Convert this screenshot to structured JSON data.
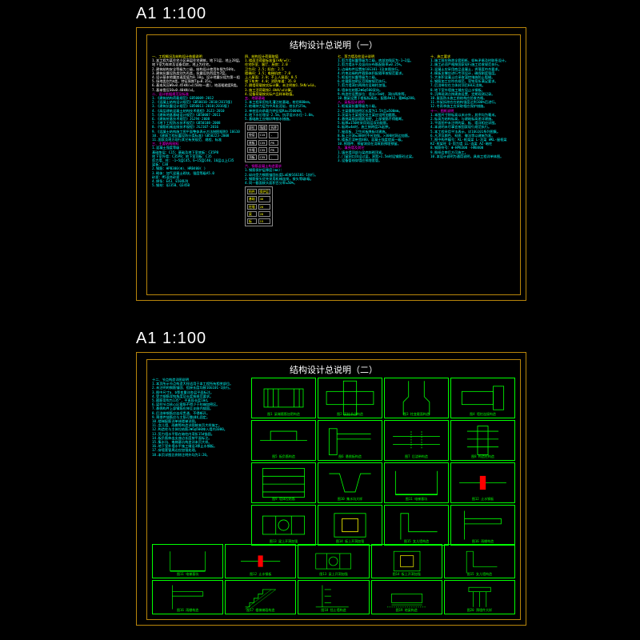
{
  "labels": {
    "sheet1": "A1   1:100",
    "sheet2": "A1   1:100"
  },
  "sheet1": {
    "title": "结构设计总说明（一）",
    "col1_head1": "一、工程概况及结构设计依据说明",
    "col1_lines_a": [
      "1.本工程为某住宅小区高层住宅建筑，地下1层，地上28层。",
      "地下室为车库及设备用房，地上为住宅。",
      "2.建筑结构安全等级为二级，结构设计使用年限为50年。",
      "3.建筑抗震设防类别为丙类，抗震设防烈度为7度。",
      "4.设计基本地震加速度值为0.10g，设计地震分组为第一组。",
      "5.场地类别为Ⅱ类，特征周期Tg=0.35s。",
      "6.基本风压W0=0.45kN/㎡(50年一遇)，地面粗糙度B类。",
      "7.基本雪压S0=0.40kN/㎡。"
    ],
    "col1_head2": "二、设计依据规范及标准",
    "col1_lines_b": [
      "1.《建筑结构荷载规范》GB50009-2012",
      "2.《混凝土结构设计规范》GB50010-2010(2015版)",
      "3.《建筑抗震设计规范》GB50011-2010(2016版)",
      "4.《高层建筑混凝土结构技术规程》JGJ3-2010",
      "5.《建筑地基基础设计规范》GB50007-2011",
      "6.《建筑桩基技术规范》JGJ94-2008",
      "7.《地下工程防水技术规范》GB50108-2008",
      "8.《钢筋机械连接技术规程》JGJ107-2016",
      "9.《混凝土结构施工图平面整体表示方法制图规则》16G101",
      "10.《建筑工程抗震设防分类标准》GB50223-2008",
      "11.国家及地方现行其它有关规范、规程、标准"
    ],
    "col1_head3": "三、主要结构材料",
    "col1_lines_c": [
      "1.混凝土强度等级：",
      "  基础垫层：C15；基础及地下室底板：C35P8",
      "  地下室外墙：C35P8；地下室顶板：C35",
      "  剪力墙、柱：-1~5层C45，6~15层C40，16层以上C35",
      "  梁板：C30",
      "2.钢筋：HPB300(Φ)、HRB400(    )",
      "3.砌体：加气混凝土砌块，强度等级A5.0",
      "  砂浆：M5混合砂浆",
      "4.焊条：E43、E50系列",
      "5.钢材：Q235B、Q345B"
    ],
    "col2_head1": "四、结构设计荷载取值",
    "col2_lines_a": [
      "1.楼面活荷载标准值(kN/㎡)：",
      "  住宅卧室、客厅、厨房：2.0",
      "  卫生间：2.5；阳台：2.5",
      "  楼梯间：3.5；电梯机房：7.0",
      "  上人屋面：2.0；不上人屋面：0.5",
      "  地下车库：4.0；消防车道：35.0",
      "2.隔墙荷载按实际计算，未注明按1.5kN/㎡计。",
      "3.施工活荷载按2.0kN/㎡计算。",
      "4.设备荷载按实际产品样本取值。"
    ],
    "col2_head2": "五、地基基础",
    "col2_lines_b": [
      "1.本工程采用钻孔灌注桩基础，桩径800mm。",
      "2.桩端持力层为中风化泥岩，桩长约25m。",
      "3.单桩竖向承载力特征值Ra=3500kN。",
      "4.地下水位埋深-2.5m，抗浮设计水位-1.0m。",
      "5.基础施工应做好降排水措施。"
    ],
    "col2_table1": {
      "header": [
        "部位",
        "强度",
        "抗渗"
      ],
      "rows": [
        [
          "垫层",
          "C15",
          "-"
        ],
        [
          "底板",
          "C35",
          "P8"
        ],
        [
          "外墙",
          "C35",
          "P8"
        ],
        [
          "顶板",
          "C35",
          "-"
        ]
      ]
    },
    "col2_head3": "六、钢筋混凝土构造要求",
    "col2_lines_c": [
      "1.钢筋保护层厚度(mm)：",
      "2.纵向受力钢筋锚固长度LaE按16G101-1执行。",
      "3.钢筋接头优先采用机械连接，接头等级Ⅰ级。",
      "4.同一截面接头面积百分率≤50%。"
    ],
    "col2_table2": {
      "header": [
        "构件",
        "保护层"
      ],
      "rows": [
        [
          "基础",
          "40"
        ],
        [
          "柱墙",
          "20"
        ],
        [
          "梁",
          "20"
        ],
        [
          "板",
          "15"
        ]
      ]
    },
    "col3_head1": "七、剪力墙及柱设计说明",
    "col3_lines_a": [
      "1.剪力墙抗震等级为二级，底部加强区为-1~2层。",
      "2.剪力墙水平及竖向分布筋配筋率≥0.25%。",
      "3.边缘构件设置按16G101-1及本图执行。",
      "4.约束边缘构件箍筋体积配箍率按规范要求。",
      "5.框架柱抗震等级为二级。",
      "6.柱箍筋加密区范围按规范执行。",
      "7.剪力墙洞口两侧应设暗柱加强。",
      "8.墙体拉结筋2Φ6@500双向。",
      "9.构造柱设置部位：墙长>5m时、洞口两侧等。",
      "10.圈梁设置于楼板标高处，配筋4Φ12，箍Φ6@200。"
    ],
    "col3_head2": "八、梁板设计说明",
    "col3_lines_b": [
      "1.框架梁抗震等级为二级。",
      "2.主梁箍筋加密区长度为1.5h且≥500mm。",
      "3.次梁与主梁相交处主梁应设附加箍筋。",
      "4.悬挑梁根部箍筋加密，上部钢筋不得截断。",
      "5.板厚≥150时采用双层双向配筋。",
      "6.板跨≥4m时，施工按跨度2‰起拱。",
      "7.屋面板、卫生间板降板详建施。",
      "8.板上开洞≤300时不另加强，>300时洞边加筋。",
      "9.楼板后浇带宽800，混凝土强度提高一级。",
      "10.预埋件、预留洞须在浇筑前预埋预留。"
    ],
    "col3_head3": "九、填充墙及其它",
    "col3_lines_c": [
      "1.填充墙顶部与梁底斜砌顶紧。",
      "2.门窗洞口顶设过梁，洞宽>1.5m时设钢筋砼过梁。",
      "3.设备管线穿墙应预埋套管。"
    ],
    "col4_head1": "十、施工要求",
    "col4_lines_a": [
      "1.施工前应熟悉全套图纸，如有矛盾及时联系设计。",
      "2.施工必须严格按国家现行施工验收规范执行。",
      "3.混凝土应采用商品混凝土，坍落度符合要求。",
      "4.模板支撑应进行专项设计，确保刚度强度。",
      "5.大体积混凝土应采取温控措施防止裂缝。",
      "6.钢筋加工应符合规范，弯钩弯折满足要求。",
      "7.后浇带应在主体封顶后60天浇筑。",
      "8.地下室外墙施工缝应设止水钢板。",
      "9.沉降观测点按建施设置，定期观测记录。",
      "10.屋面防水施工前结构应验收合格。",
      "11.外架拆除应在结构强度达到100%后进行。",
      "12.冬雨季施工应采取相应保护措施。"
    ],
    "col4_head2": "十一、图纸说明",
    "col4_lines_b": [
      "1.本图尺寸除标高以米计外，其余均为毫米。",
      "2.标高为结构标高，与建筑标高差详建施。",
      "3.平面图中未注明的梁、板、墙详相应详图。",
      "4.本说明未尽事宜按国家现行规范执行。",
      "5.本工程采用平法表示，详16G101系列图集。",
      "6.凡涉及颜色、材质、做法等以建施为准。",
      "7.图中构件编号：KL-框架梁 L-次梁 WKL-屋框梁",
      "  KZ-框架柱 Q-剪力墙 LL-连梁 AZ-暗柱",
      "8.钢筋符号：Φ-HPB300      -HRB400",
      "9.图纸会审后方可施工。",
      "10.本设计说明为通用说明，具体工程详单体图。"
    ]
  },
  "sheet2": {
    "title": "结构设计总说明（二）",
    "text_lines": [
      "十二、节点构造详图说明",
      "1.本页所示节点构造大样适用于本工程所有相关部位。",
      "2.未注明的钢筋锚固、搭接长度均按16G101-1执行。",
      "3.图中尺寸a、b等变量详各层平面标注。",
      "4.受力钢筋弯钩角度及长度按规范要求。",
      "5.箍筋弯钩为135°，平直段长度10d。",
      "6.梁柱节点核心区箍筋不得少于柱端加密区。",
      "7.悬挑构件上部钢筋应伸至支座内锚固。",
      "8.后浇带钢筋应连续贯通，不得断开。",
      "9.预埋件锚筋应与主筋可靠绑扎固定。",
      "10.楼梯配筋详单体楼梯详图。",
      "11.女儿墙、雨棚等构造详图按本页大样施工。",
      "12.构造柱与主体拉结筋2Φ6@500伸入墙内1000。",
      "13.剪力墙水平筋在暗柱内弯折15d锚固。",
      "14.板负筋伸出支座边长度按平面标注。",
      "15.集水坑、电梯基坑构造详本页大样。",
      "16.地下室外墙水平施工缝设3厚止水钢板。",
      "17.穿墙套管周边应加强处理。",
      "18.本页详图比例除注明外均为1:20。"
    ],
    "details": [
      "图1 梁端箍筋加密构造",
      "图2 梁柱节点构造",
      "图3 柱变截面构造",
      "图4 墙柱连接构造",
      "图5 板负筋构造",
      "图6 悬挑板构造",
      "图7 后浇带构造",
      "图8 构造柱构造",
      "图9 墙体拉结筋",
      "图10 集水坑大样",
      "图11 电梯基坑",
      "图12 止水钢板",
      "图13 梁上开洞加强",
      "图14 板上开洞加强",
      "图15 女儿墙构造",
      "图16 雨棚构造",
      "图17 楼梯梯段构造",
      "图18 挡土墙构造",
      "图19 地梁构造",
      "图20 预埋件大样"
    ]
  }
}
